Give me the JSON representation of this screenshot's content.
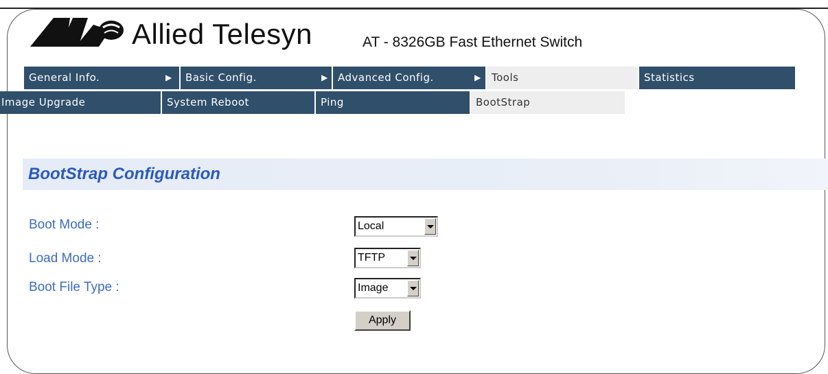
{
  "header": {
    "brand": "Allied Telesyn",
    "product": "AT - 8326GB Fast Ethernet Switch"
  },
  "menu": {
    "primary": [
      {
        "label": "General Info.",
        "has_arrow": true
      },
      {
        "label": "Basic Config.",
        "has_arrow": true
      },
      {
        "label": "Advanced Config.",
        "has_arrow": true
      },
      {
        "label": "Tools",
        "has_arrow": true,
        "active": true
      },
      {
        "label": "Statistics",
        "has_arrow": false
      }
    ],
    "secondary": [
      {
        "label": "Image Upgrade"
      },
      {
        "label": "System Reboot"
      },
      {
        "label": "Ping"
      },
      {
        "label": "BootStrap",
        "active": true
      }
    ]
  },
  "section": {
    "title": "BootStrap Configuration"
  },
  "form": {
    "boot_mode": {
      "label": "Boot Mode :",
      "value": "Local"
    },
    "load_mode": {
      "label": "Load Mode :",
      "value": "TFTP"
    },
    "boot_file_type": {
      "label": "Boot File Type :",
      "value": "Image"
    },
    "apply_label": "Apply"
  },
  "colors": {
    "menu_dark": "#2f4f6b",
    "menu_active": "#eeeeee",
    "label_blue": "#3d6bc2",
    "title_blue": "#2a59c0",
    "section_bg": "#e6ecf7"
  },
  "icons": {
    "logo": "allied-telesyn-logo-icon",
    "menu_arrow": "triangle-right-icon",
    "select_arrow": "triangle-down-icon"
  }
}
